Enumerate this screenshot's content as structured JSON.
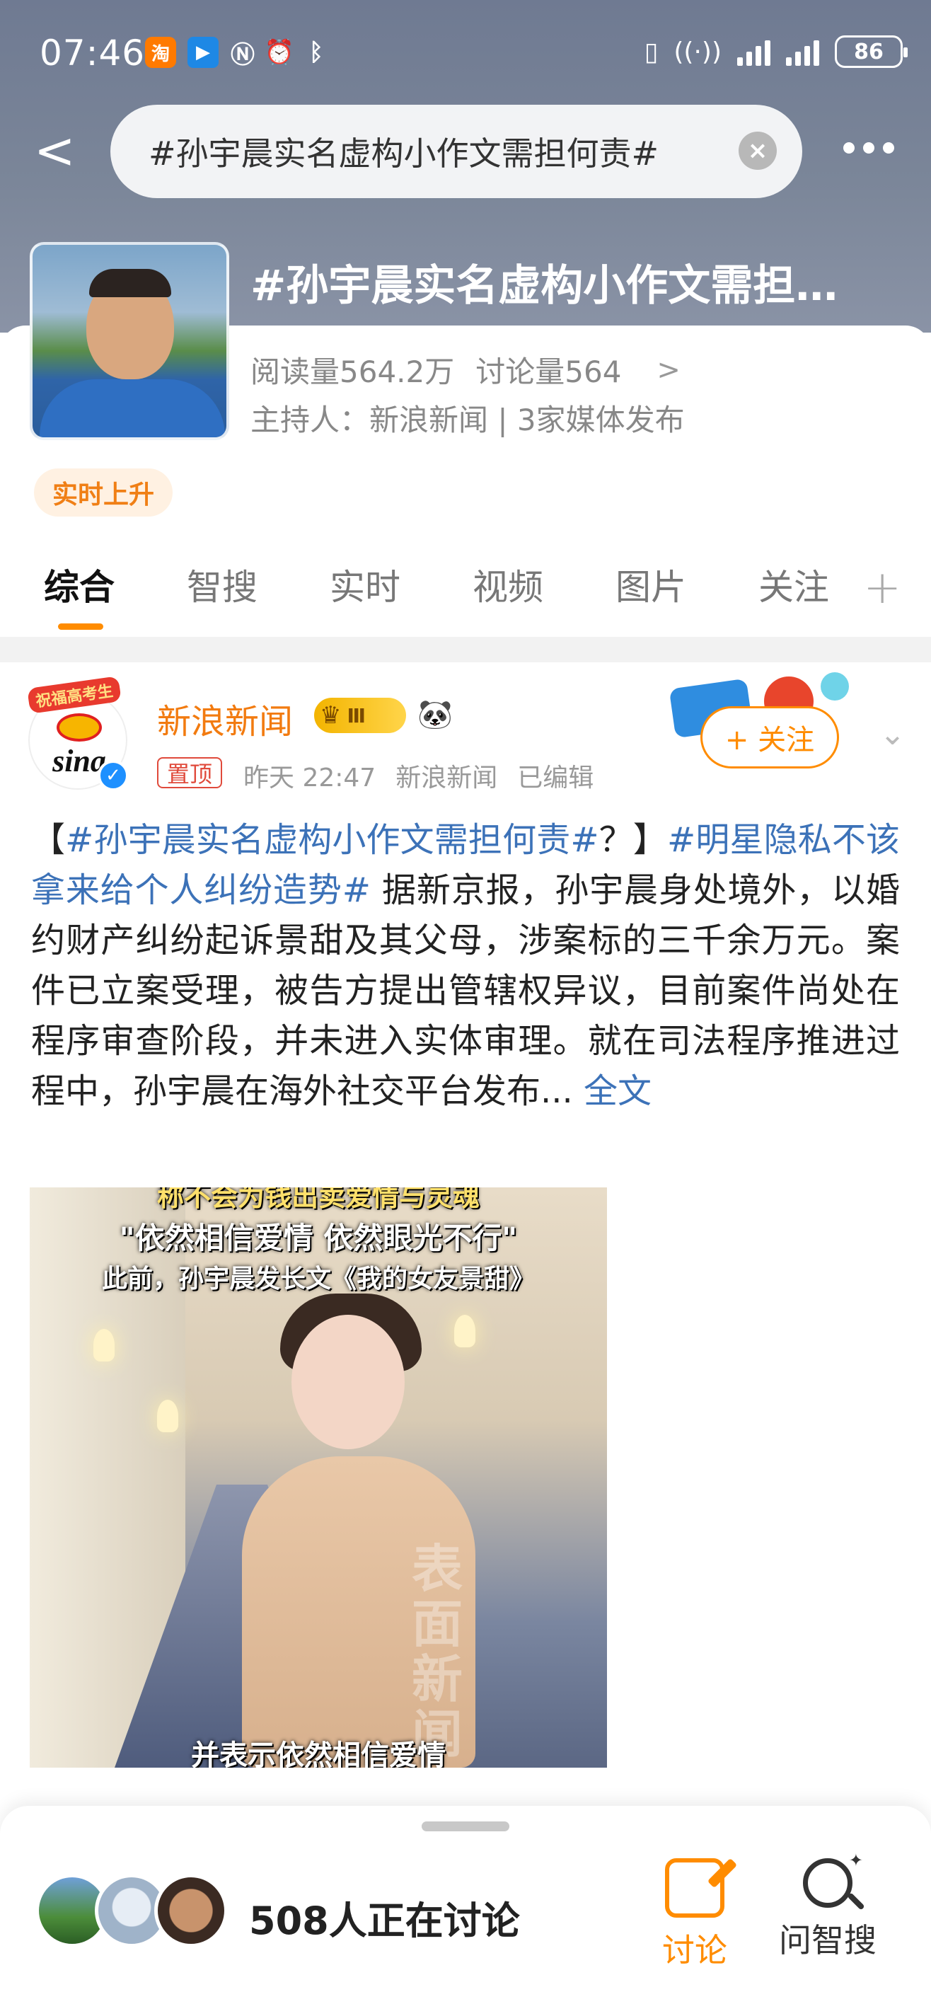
{
  "status_bar": {
    "time": "07:46",
    "left_icons": [
      "taobao-icon",
      "cast-icon",
      "nfc-icon",
      "alarm-icon",
      "bluetooth-icon"
    ],
    "taobao_glyph": "淘",
    "battery": "86"
  },
  "nav": {
    "search_text": "#孙宇晨实名虚构小作文需担何责#",
    "back_label": "<",
    "clear_label": "×"
  },
  "topic": {
    "title": "#孙宇晨实名虚构小作文需担…",
    "reads": "阅读量564.2万",
    "discussions": "讨论量564",
    "chevron": ">",
    "host": "主持人：新浪新闻 | 3家媒体发布",
    "badge": "实时上升"
  },
  "tabs": [
    {
      "label": "综合",
      "active": true
    },
    {
      "label": "智搜",
      "active": false
    },
    {
      "label": "实时",
      "active": false
    },
    {
      "label": "视频",
      "active": false
    },
    {
      "label": "图片",
      "active": false
    },
    {
      "label": "关注",
      "active": false
    }
  ],
  "tab_add": "+",
  "post": {
    "avatar_ring": "祝福高考生",
    "avatar_logo": "sina",
    "author": "新浪新闻",
    "level_badge": "Ⅲ",
    "pinned": "置顶",
    "time": "昨天 22:47",
    "source": "新浪新闻",
    "edited": "已编辑",
    "follow": "+ 关注",
    "text_open": "【",
    "tag1": "#孙宇晨实名虚构小作文需担何责#",
    "text_q": "？】",
    "tag2": "#明星隐私不该拿来给个人纠纷造势#",
    "body": " 据新京报，孙宇晨身处境外，以婚约财产纠纷起诉景甜及其父母，涉案标的三千余万元。案件已立案受理，被告方提出管辖权异议，目前案件尚处在程序审查阶段，并未进入实体审理。就在司法程序推进过程中，孙宇晨在海外社交平台发布...",
    "more": " 全文",
    "image_captions": [
      "称不会为钱出卖爱情与灵魂",
      "\"依然相信爱情 依然眼光不行\"",
      "此前，孙宇晨发长文《我的女友景甜》",
      "并表示依然相信爱情"
    ],
    "watermark": "表面新闻"
  },
  "bottom": {
    "count": "508人正在讨论",
    "discuss_label": "讨论",
    "ask_label": "问智搜"
  }
}
